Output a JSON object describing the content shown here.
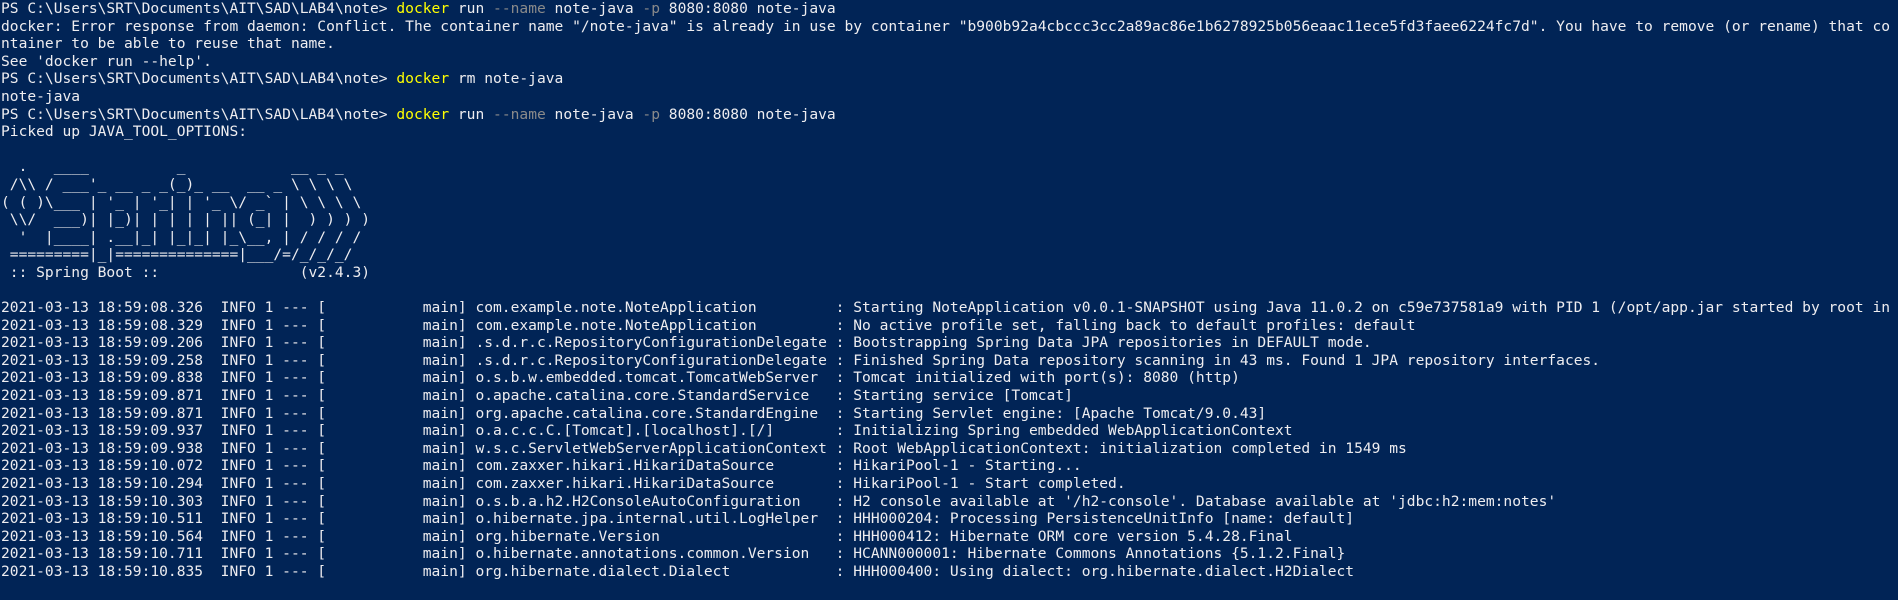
{
  "window": {
    "background_color": "#012456",
    "text_color": "#eeedf0",
    "command_color": "#ffff00",
    "parameter_color": "#8a8a8a"
  },
  "session": {
    "prompt": "PS C:\\Users\\SRT\\Documents\\AIT\\SAD\\LAB4\\note> ",
    "cmd1": {
      "program": "docker",
      "rest1": " run ",
      "flag_name": "--name",
      "rest2": " note-java ",
      "flag_p": "-p",
      "rest3": " 8080:8080 note-java"
    },
    "error_line": "docker: Error response from daemon: Conflict. The container name \"/note-java\" is already in use by container \"b900b92a4cbccc3cc2a89ac86e1b6278925b056eaac11ece5fd3faee6224fc7d\". You have to remove (or rename) that container to be able to reuse that name.",
    "help_hint": "See 'docker run --help'.",
    "cmd2": {
      "program": "docker",
      "rest": " rm note-java"
    },
    "rm_output": "note-java",
    "cmd3": {
      "program": "docker",
      "rest1": " run ",
      "flag_name": "--name",
      "rest2": " note-java ",
      "flag_p": "-p",
      "rest3": " 8080:8080 note-java"
    },
    "picked_up": "Picked up JAVA_TOOL_OPTIONS:",
    "banner": [
      "",
      "  .   ____          _            __ _ _",
      " /\\\\ / ___'_ __ _ _(_)_ __  __ _ \\ \\ \\ \\",
      "( ( )\\___ | '_ | '_| | '_ \\/ _` | \\ \\ \\ \\",
      " \\\\/  ___)| |_)| | | | | || (_| |  ) ) ) )",
      "  '  |____| .__|_| |_|_| |_\\__, | / / / /",
      " =========|_|==============|___/=/_/_/_/",
      " :: Spring Boot ::                (v2.4.3)",
      ""
    ],
    "logs": [
      "2021-03-13 18:59:08.326  INFO 1 --- [           main] com.example.note.NoteApplication         : Starting NoteApplication v0.0.1-SNAPSHOT using Java 11.0.2 on c59e737581a9 with PID 1 (/opt/app.jar started by root in /opt)",
      "2021-03-13 18:59:08.329  INFO 1 --- [           main] com.example.note.NoteApplication         : No active profile set, falling back to default profiles: default",
      "2021-03-13 18:59:09.206  INFO 1 --- [           main] .s.d.r.c.RepositoryConfigurationDelegate : Bootstrapping Spring Data JPA repositories in DEFAULT mode.",
      "2021-03-13 18:59:09.258  INFO 1 --- [           main] .s.d.r.c.RepositoryConfigurationDelegate : Finished Spring Data repository scanning in 43 ms. Found 1 JPA repository interfaces.",
      "2021-03-13 18:59:09.838  INFO 1 --- [           main] o.s.b.w.embedded.tomcat.TomcatWebServer  : Tomcat initialized with port(s): 8080 (http)",
      "2021-03-13 18:59:09.871  INFO 1 --- [           main] o.apache.catalina.core.StandardService   : Starting service [Tomcat]",
      "2021-03-13 18:59:09.871  INFO 1 --- [           main] org.apache.catalina.core.StandardEngine  : Starting Servlet engine: [Apache Tomcat/9.0.43]",
      "2021-03-13 18:59:09.937  INFO 1 --- [           main] o.a.c.c.C.[Tomcat].[localhost].[/]       : Initializing Spring embedded WebApplicationContext",
      "2021-03-13 18:59:09.938  INFO 1 --- [           main] w.s.c.ServletWebServerApplicationContext : Root WebApplicationContext: initialization completed in 1549 ms",
      "2021-03-13 18:59:10.072  INFO 1 --- [           main] com.zaxxer.hikari.HikariDataSource       : HikariPool-1 - Starting...",
      "2021-03-13 18:59:10.294  INFO 1 --- [           main] com.zaxxer.hikari.HikariDataSource       : HikariPool-1 - Start completed.",
      "2021-03-13 18:59:10.303  INFO 1 --- [           main] o.s.b.a.h2.H2ConsoleAutoConfiguration    : H2 console available at '/h2-console'. Database available at 'jdbc:h2:mem:notes'",
      "2021-03-13 18:59:10.511  INFO 1 --- [           main] o.hibernate.jpa.internal.util.LogHelper  : HHH000204: Processing PersistenceUnitInfo [name: default]",
      "2021-03-13 18:59:10.564  INFO 1 --- [           main] org.hibernate.Version                    : HHH000412: Hibernate ORM core version 5.4.28.Final",
      "2021-03-13 18:59:10.711  INFO 1 --- [           main] o.hibernate.annotations.common.Version   : HCANN000001: Hibernate Commons Annotations {5.1.2.Final}",
      "2021-03-13 18:59:10.835  INFO 1 --- [           main] org.hibernate.dialect.Dialect            : HHH000400: Using dialect: org.hibernate.dialect.H2Dialect"
    ]
  }
}
